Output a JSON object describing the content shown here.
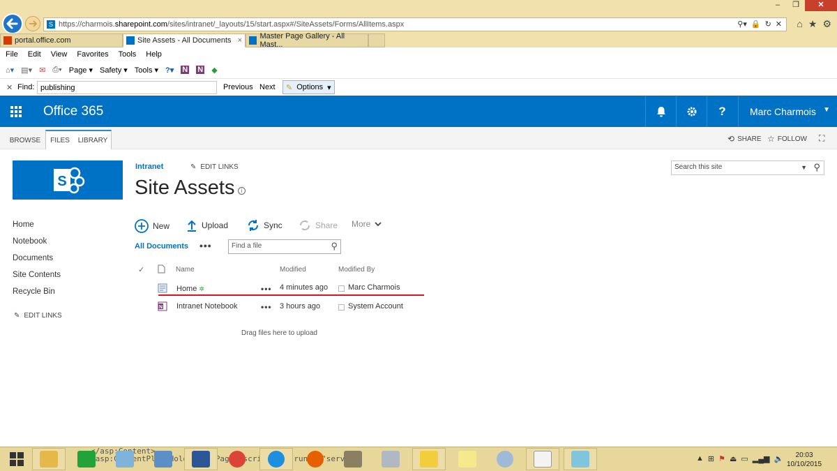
{
  "browser": {
    "address_url_prefix": "https://charmois.",
    "address_url_host": "sharepoint.com",
    "address_url_suffix": "/sites/intranet/_layouts/15/start.aspx#/SiteAssets/Forms/AllItems.aspx",
    "tabs": [
      {
        "label": "portal.office.com",
        "active": false,
        "close": ""
      },
      {
        "label": "Site Assets - All Documents",
        "active": true,
        "close": "×"
      },
      {
        "label": "Master Page Gallery - All Mast...",
        "active": false,
        "close": ""
      }
    ],
    "menu": [
      "File",
      "Edit",
      "View",
      "Favorites",
      "Tools",
      "Help"
    ],
    "commands": {
      "page": "Page",
      "safety": "Safety",
      "tools": "Tools"
    },
    "find": {
      "label": "Find:",
      "value": "publishing",
      "previous": "Previous",
      "next": "Next",
      "options": "Options",
      "close": "✕"
    }
  },
  "suite": {
    "brand": "Office 365",
    "user": "Marc Charmois",
    "icons": [
      "bell-icon",
      "gear-icon",
      "help-icon"
    ],
    "colors": {
      "bar": "#0072c6"
    }
  },
  "ribbon": {
    "tabs": [
      "BROWSE",
      "FILES",
      "LIBRARY"
    ],
    "share": "SHARE",
    "follow": "FOLLOW"
  },
  "site": {
    "breadcrumb": "Intranet",
    "edit_links": "EDIT LINKS",
    "title": "Site Assets",
    "search_placeholder": "Search this site"
  },
  "quicklaunch": {
    "items": [
      "Home",
      "Notebook",
      "Documents",
      "Site Contents",
      "Recycle Bin"
    ],
    "edit_links": "EDIT LINKS"
  },
  "toolbar": {
    "new": "New",
    "upload": "Upload",
    "sync": "Sync",
    "share": "Share",
    "more": "More"
  },
  "view": {
    "name": "All Documents",
    "ellipsis": "•••",
    "find_placeholder": "Find a file"
  },
  "list": {
    "headers": {
      "name": "Name",
      "modified": "Modified",
      "modified_by": "Modified By"
    },
    "rows": [
      {
        "name": "Home",
        "new_badge": "✲",
        "modified": "4 minutes ago",
        "modified_by": "Marc Charmois"
      },
      {
        "name": "Intranet Notebook",
        "new_badge": "",
        "modified": "3 hours ago",
        "modified_by": "System Account"
      }
    ],
    "drag_hint": "Drag files here to upload"
  },
  "taskbar": {
    "background_code": "</asp:Content>\n<asp:ContentPlaceHolder... PageDescription\" runat=\"serv",
    "time": "20:03",
    "date": "10/10/2015"
  }
}
